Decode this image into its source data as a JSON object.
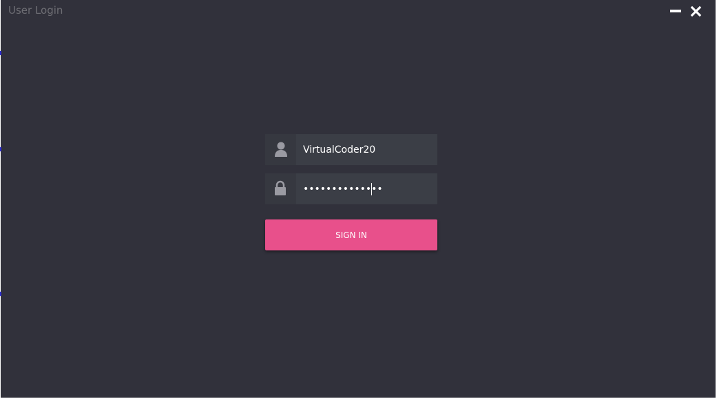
{
  "window": {
    "title": "User Login",
    "controls": {
      "minimize_icon": "minimize-icon",
      "close_icon": "close-icon"
    }
  },
  "login_form": {
    "username": {
      "icon": "user-icon",
      "value": "VirtualCoder20"
    },
    "password": {
      "icon": "lock-icon",
      "masked_value": "••••••••••••••"
    },
    "sign_in_label": "SIGN IN"
  },
  "colors": {
    "background": "#31313b",
    "field_background": "#3b3e46",
    "button_accent": "#e8508b",
    "title_text": "#6e6e74"
  }
}
